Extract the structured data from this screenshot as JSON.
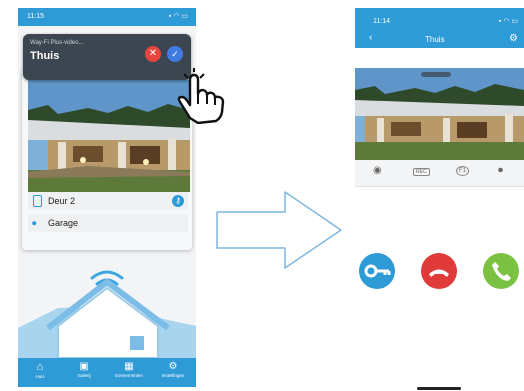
{
  "left_phone": {
    "status_time": "11:15",
    "notification": {
      "app_label": "Way-Fi Plus-video...",
      "title": "Thuis"
    },
    "rows": [
      {
        "label": "Deur 2",
        "icon": "door-icon"
      },
      {
        "label": "Garage",
        "icon": "camera-icon"
      }
    ],
    "nav": [
      {
        "label": "Huis",
        "icon": "home-icon"
      },
      {
        "label": "Galerij",
        "icon": "gallery-icon"
      },
      {
        "label": "Evenementen",
        "icon": "calendar-icon"
      },
      {
        "label": "Instellingen",
        "icon": "settings-icon"
      }
    ]
  },
  "right_phone": {
    "status_time": "11:14",
    "header_title": "Thuis",
    "controls": [
      "REC",
      "F1"
    ],
    "call_buttons": [
      {
        "name": "unlock",
        "color": "#2e9ad6"
      },
      {
        "name": "hang-up",
        "color": "#e03a3a"
      },
      {
        "name": "answer",
        "color": "#7cc242"
      }
    ]
  },
  "colors": {
    "brand_blue": "#2e9ad6",
    "accept_blue": "#3f7be0",
    "decline_red": "#e8443e"
  }
}
